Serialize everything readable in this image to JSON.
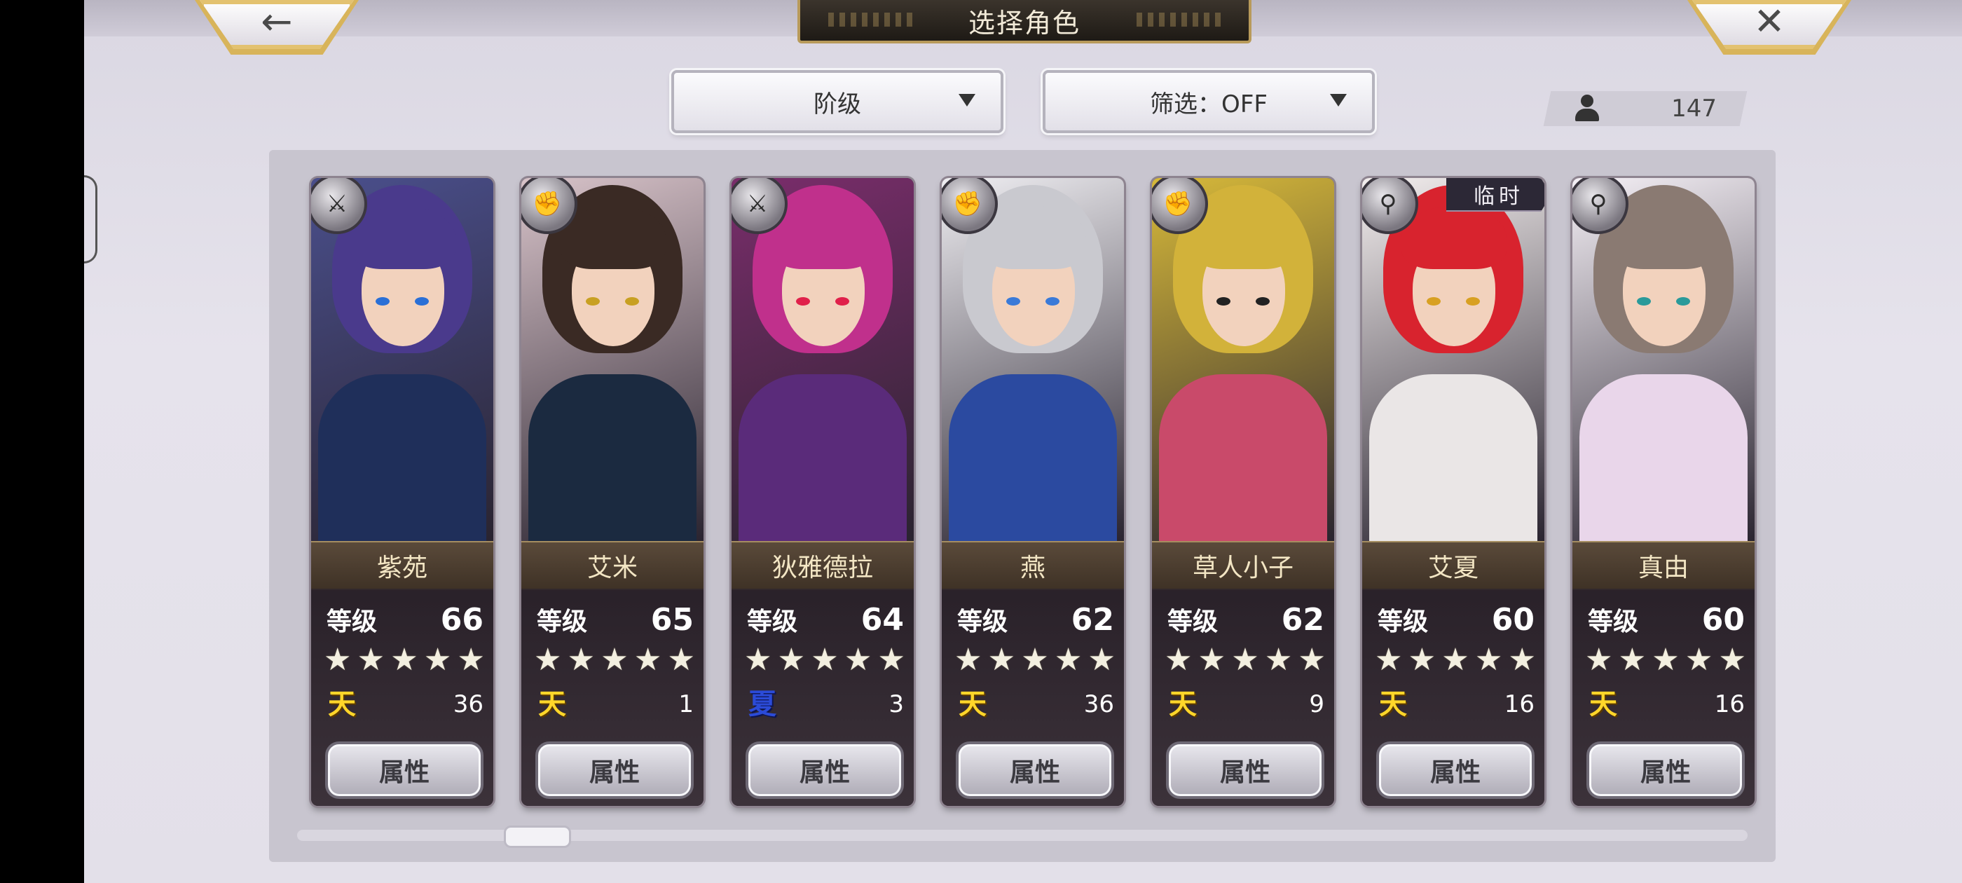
{
  "header": {
    "title": "选择角色",
    "back_icon": "←",
    "close_icon": "✕"
  },
  "toolbar": {
    "sort_label": "阶级",
    "filter_label": "筛选：OFF",
    "roster_count": "147"
  },
  "temp_tag": "临时",
  "attr_label": "属性",
  "level_key": "等级",
  "stars": [
    "★",
    "★",
    "★",
    "★",
    "★"
  ],
  "scroll": {
    "position": 0.05
  },
  "characters": [
    {
      "name": "紫苑",
      "level": "66",
      "element": "天",
      "element_value": "36",
      "type_icon": "sword-icon",
      "glyph": "⚔",
      "colors": {
        "bg": "#4a4f8c",
        "hair": "#4a3a8c",
        "body": "#1f2f5a",
        "eye": "#2a6fd6"
      }
    },
    {
      "name": "艾米",
      "level": "65",
      "element": "天",
      "element_value": "1",
      "type_icon": "fist-icon",
      "glyph": "✊",
      "colors": {
        "bg": "#d8c3c9",
        "hair": "#3a2a24",
        "body": "#1b2a40",
        "eye": "#c8a022"
      }
    },
    {
      "name": "狄雅德拉",
      "level": "64",
      "element": "夏",
      "element_value": "3",
      "type_icon": "sword-icon",
      "glyph": "⚔",
      "colors": {
        "bg": "#7a2d6b",
        "hair": "#c0308c",
        "body": "#5a2b7a",
        "eye": "#e0204a"
      }
    },
    {
      "name": "燕",
      "level": "62",
      "element": "天",
      "element_value": "36",
      "type_icon": "fist-icon",
      "glyph": "✊",
      "colors": {
        "bg": "#efeef2",
        "hair": "#c9c9cf",
        "body": "#2b4aa0",
        "eye": "#3a7ad8"
      }
    },
    {
      "name": "草人小子",
      "level": "62",
      "element": "天",
      "element_value": "9",
      "type_icon": "fist-icon",
      "glyph": "✊",
      "colors": {
        "bg": "#d7b93a",
        "hair": "#d2b23a",
        "body": "#c94a6a",
        "eye": "#222222"
      }
    },
    {
      "name": "艾夏",
      "level": "60",
      "element": "天",
      "element_value": "16",
      "type_icon": "staff-icon",
      "glyph": "⚲",
      "colors": {
        "bg": "#f3eeee",
        "hair": "#d8232e",
        "body": "#eae6e6",
        "eye": "#d8a022"
      }
    },
    {
      "name": "真由",
      "level": "60",
      "element": "天",
      "element_value": "16",
      "type_icon": "staff-icon",
      "glyph": "⚲",
      "colors": {
        "bg": "#f5f0f6",
        "hair": "#8a7a72",
        "body": "#e9d6ea",
        "eye": "#2a9a9a"
      }
    }
  ]
}
